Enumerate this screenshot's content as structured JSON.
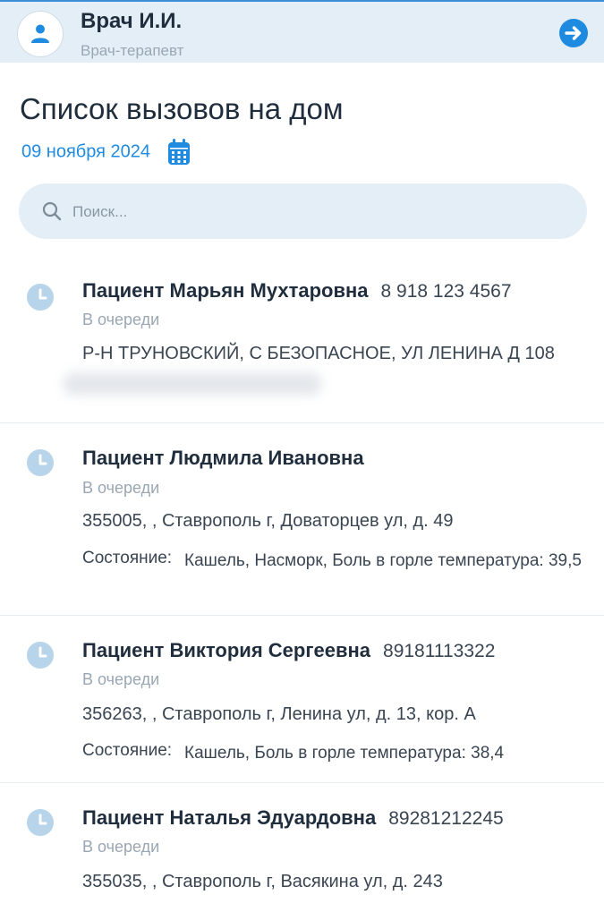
{
  "header": {
    "doctor_name": "Врач И.И.",
    "doctor_role": "Врач-терапевт",
    "avatar_icon": "user-icon",
    "logout_icon": "arrow-right-circle-icon"
  },
  "page": {
    "title": "Список вызовов на дом",
    "date": "09 ноября 2024",
    "calendar_icon": "calendar-icon"
  },
  "search": {
    "placeholder": "Поиск...",
    "value": ""
  },
  "colors": {
    "accent": "#1f8be0",
    "header_bg": "#e3eef7",
    "clock_icon": "#b7d4ea"
  },
  "calls": [
    {
      "name": "Пациент Марьян Мухтаровна",
      "phone": "8 918 123 4567",
      "status": "В очереди",
      "address": "Р-Н ТРУНОВСКИЙ, С БЕЗОПАСНОЕ, УЛ ЛЕНИНА Д 108",
      "condition_label": "",
      "condition": ""
    },
    {
      "name": "Пациент Людмила Ивановна",
      "phone": "",
      "status": "В очереди",
      "address": "355005, , Ставрополь г, Доваторцев ул, д. 49",
      "condition_label": "Состояние:",
      "condition": "Кашель, Насморк, Боль в горле  температура: 39,5"
    },
    {
      "name": "Пациент Виктория Сергеевна",
      "phone": "89181113322",
      "status": "В очереди",
      "address": "356263, , Ставрополь г, Ленина ул, д. 13, кор. А",
      "condition_label": "Состояние:",
      "condition": "Кашель, Боль в горле  температура: 38,4"
    },
    {
      "name": "Пациент Наталья Эдуардовна",
      "phone": "89281212245",
      "status": "В очереди",
      "address": "355035, , Ставрополь г, Васякина ул, д. 243",
      "condition_label": "",
      "condition": ""
    }
  ]
}
